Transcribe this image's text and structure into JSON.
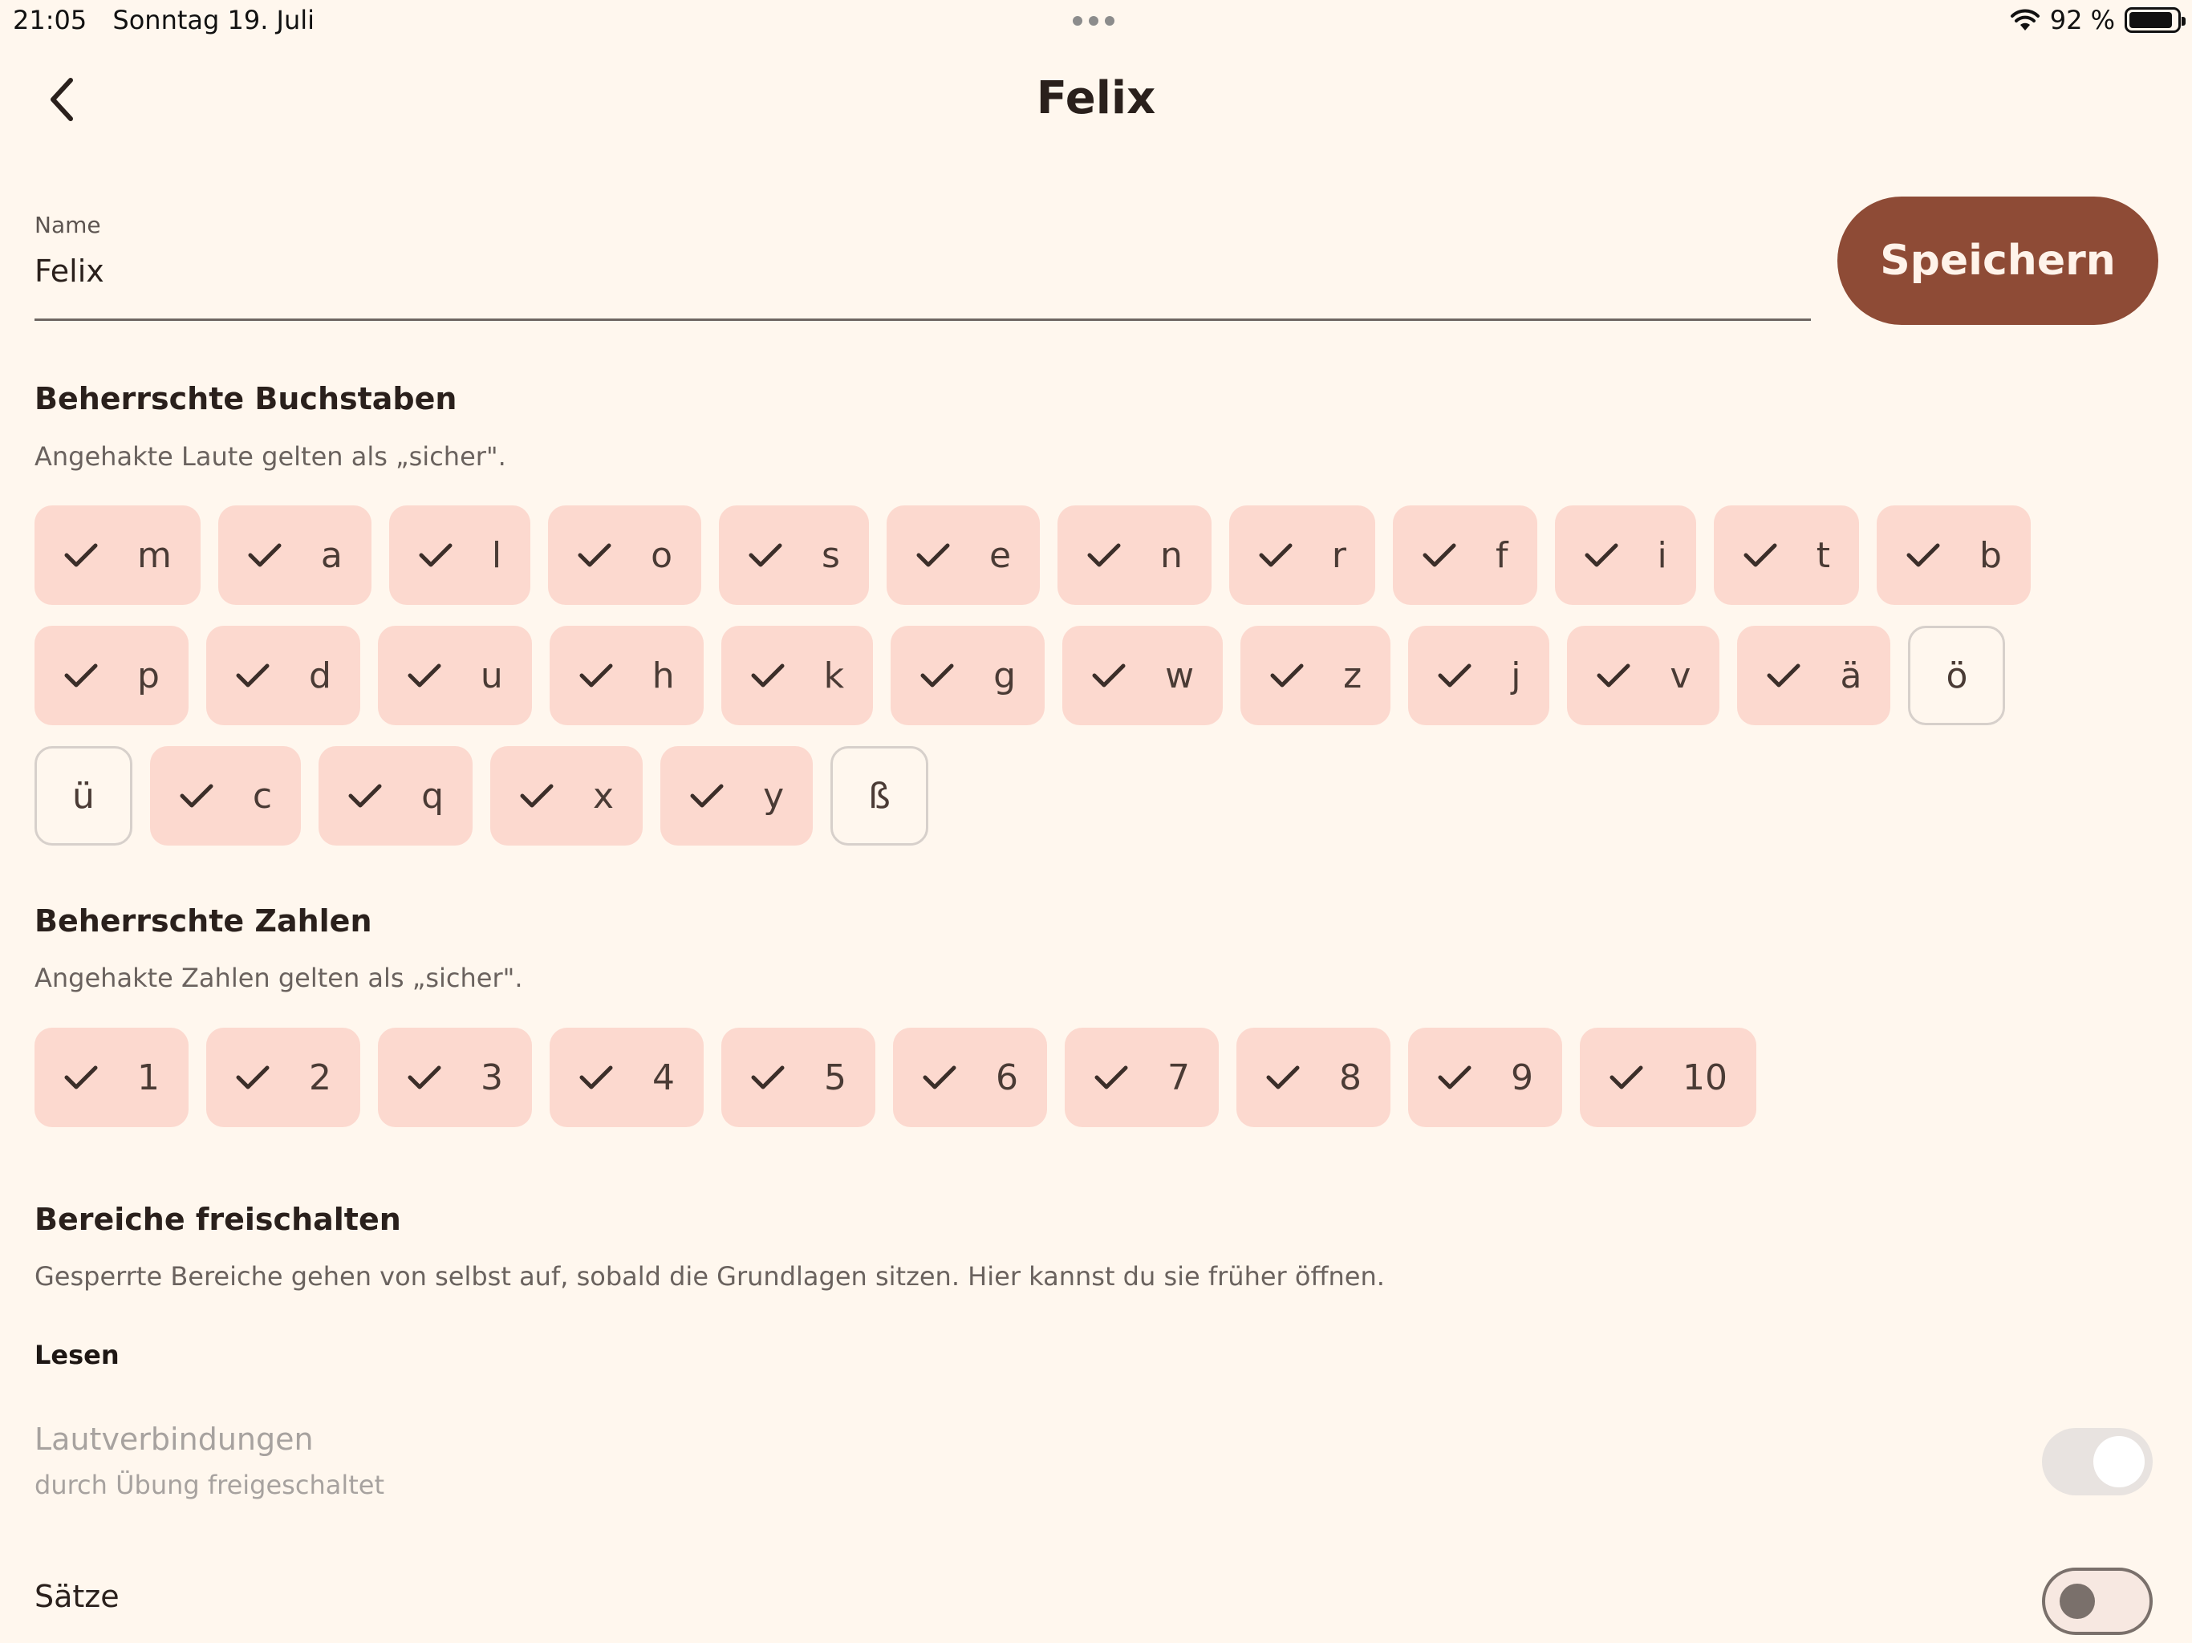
{
  "status_bar": {
    "time": "21:05",
    "date": "Sonntag 19. Juli",
    "battery_text": "92 %",
    "battery_level": 0.92,
    "icons": [
      "wifi-icon",
      "battery-icon"
    ]
  },
  "header": {
    "title": "Felix",
    "back_icon": "chevron-left-icon"
  },
  "name_field": {
    "label": "Name",
    "value": "Felix"
  },
  "save_button": {
    "label": "Speichern"
  },
  "colors": {
    "background": "#FFF7EE",
    "accent": "#8E4B36",
    "chip_checked": "#FCD9CF"
  },
  "letters": {
    "title": "Beherrschte Buchstaben",
    "description": "Angehakte Laute gelten als „sicher\".",
    "rows": [
      [
        {
          "label": "m",
          "checked": true
        },
        {
          "label": "a",
          "checked": true
        },
        {
          "label": "l",
          "checked": true
        },
        {
          "label": "o",
          "checked": true
        },
        {
          "label": "s",
          "checked": true
        },
        {
          "label": "e",
          "checked": true
        },
        {
          "label": "n",
          "checked": true
        },
        {
          "label": "r",
          "checked": true
        },
        {
          "label": "f",
          "checked": true
        },
        {
          "label": "i",
          "checked": true
        },
        {
          "label": "t",
          "checked": true
        },
        {
          "label": "b",
          "checked": true
        }
      ],
      [
        {
          "label": "p",
          "checked": true
        },
        {
          "label": "d",
          "checked": true
        },
        {
          "label": "u",
          "checked": true
        },
        {
          "label": "h",
          "checked": true
        },
        {
          "label": "k",
          "checked": true
        },
        {
          "label": "g",
          "checked": true
        },
        {
          "label": "w",
          "checked": true
        },
        {
          "label": "z",
          "checked": true
        },
        {
          "label": "j",
          "checked": true
        },
        {
          "label": "v",
          "checked": true
        },
        {
          "label": "ä",
          "checked": true
        },
        {
          "label": "ö",
          "checked": false
        }
      ],
      [
        {
          "label": "ü",
          "checked": false
        },
        {
          "label": "c",
          "checked": true
        },
        {
          "label": "q",
          "checked": true
        },
        {
          "label": "x",
          "checked": true
        },
        {
          "label": "y",
          "checked": true
        },
        {
          "label": "ß",
          "checked": false
        }
      ]
    ]
  },
  "numbers": {
    "title": "Beherrschte Zahlen",
    "description": "Angehakte Zahlen gelten als „sicher\".",
    "items": [
      {
        "label": "1",
        "checked": true
      },
      {
        "label": "2",
        "checked": true
      },
      {
        "label": "3",
        "checked": true
      },
      {
        "label": "4",
        "checked": true
      },
      {
        "label": "5",
        "checked": true
      },
      {
        "label": "6",
        "checked": true
      },
      {
        "label": "7",
        "checked": true
      },
      {
        "label": "8",
        "checked": true
      },
      {
        "label": "9",
        "checked": true
      },
      {
        "label": "10",
        "checked": true
      }
    ]
  },
  "unlock": {
    "title": "Bereiche freischalten",
    "description": "Gesperrte Bereiche gehen von selbst auf, sobald die Grundlagen sitzen. Hier kannst du sie früher öffnen.",
    "subheading": "Lesen",
    "toggles": [
      {
        "title": "Lautverbindungen",
        "subtitle": "durch Übung freigeschaltet",
        "on": true,
        "disabled": true
      },
      {
        "title": "Sätze",
        "subtitle": "",
        "on": false,
        "disabled": false
      }
    ]
  }
}
